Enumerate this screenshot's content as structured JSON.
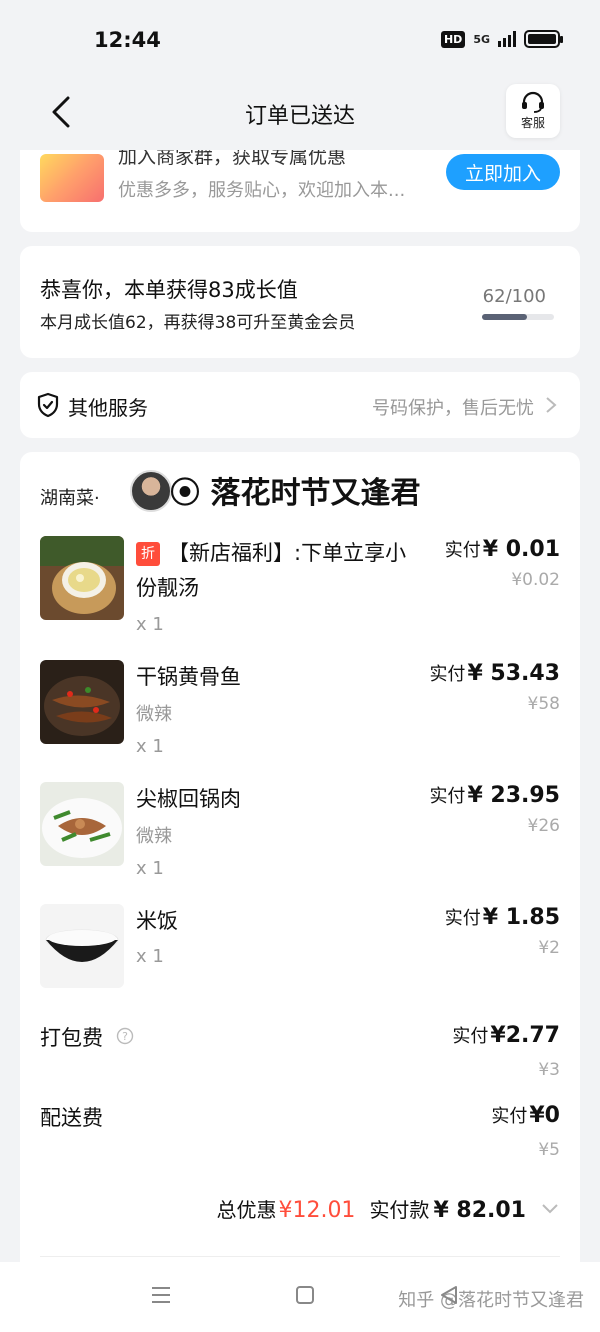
{
  "status": {
    "time": "12:44",
    "hd": "HD",
    "net": "5G"
  },
  "nav": {
    "title": "订单已送达",
    "service_label": "客服"
  },
  "join": {
    "title": "加入商家群，获取专属优惠",
    "subtitle": "优惠多多，服务贴心，欢迎加入本...",
    "button": "立即加入"
  },
  "growth": {
    "title": "恭喜你，本单获得83成长值",
    "subtitle": "本月成长值62，再获得38可升至黄金会员",
    "progress_text": "62/100",
    "progress": 0.62
  },
  "services": {
    "label": "其他服务",
    "value": "号码保护，售后无忧"
  },
  "order": {
    "shop": "湖南菜·",
    "watermark": "落花时节又逢君",
    "items": [
      {
        "tag": "折",
        "name": "【新店福利】:下单立享小份靓汤",
        "spec": "",
        "qty": "x 1",
        "price_label": "实付",
        "price": "¥ 0.01",
        "orig": "¥0.02"
      },
      {
        "tag": "",
        "name": "干锅黄骨鱼",
        "spec": "微辣",
        "qty": "x 1",
        "price_label": "实付",
        "price": "¥ 53.43",
        "orig": "¥58"
      },
      {
        "tag": "",
        "name": "尖椒回锅肉",
        "spec": "微辣",
        "qty": "x 1",
        "price_label": "实付",
        "price": "¥ 23.95",
        "orig": "¥26"
      },
      {
        "tag": "",
        "name": "米饭",
        "spec": "",
        "qty": "x 1",
        "price_label": "实付",
        "price": "¥ 1.85",
        "orig": "¥2"
      }
    ],
    "fees": [
      {
        "label": "打包费",
        "price_label": "实付",
        "price": "¥2.77",
        "orig": "¥3"
      },
      {
        "label": "配送费",
        "price_label": "实付",
        "price": "¥0",
        "orig": "¥5"
      }
    ],
    "total": {
      "discount_label": "总优惠",
      "discount": "¥12.01",
      "pay_label": "实付款",
      "pay": "¥ 82.01"
    }
  },
  "footer": {
    "watermark": "知乎 @落花时节又逢君"
  },
  "colors": {
    "accent": "#1ea0ff",
    "discount": "#ff4d3b",
    "background": "#f2f3f5"
  }
}
